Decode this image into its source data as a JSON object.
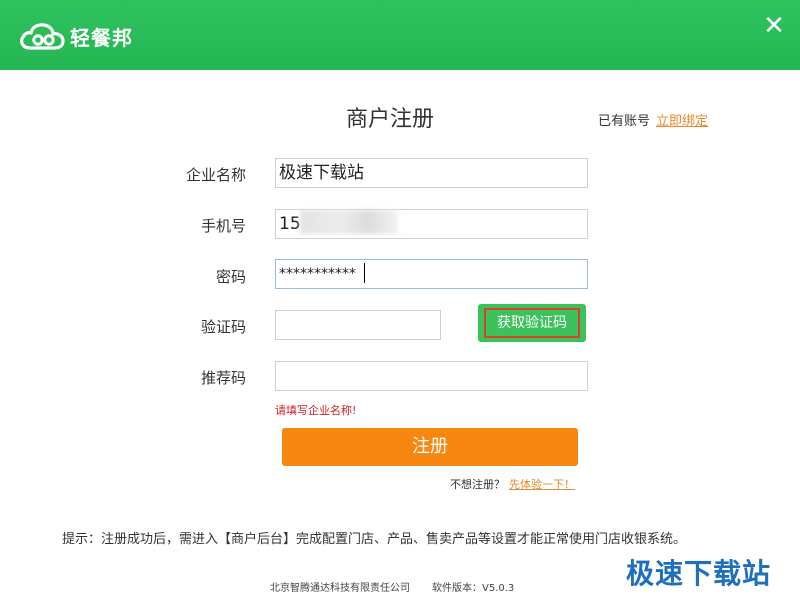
{
  "app": {
    "name": "轻餐邦"
  },
  "header": {
    "close_glyph": "✕",
    "accent_color": "#2fc35f"
  },
  "page": {
    "title": "商户注册"
  },
  "account": {
    "text": "已有账号",
    "link": "立即绑定"
  },
  "form": {
    "company": {
      "label": "企业名称",
      "value": "极速下载站"
    },
    "phone": {
      "label": "手机号",
      "value": "15"
    },
    "password": {
      "label": "密码",
      "value": "***********"
    },
    "code": {
      "label": "验证码",
      "value": "",
      "button": "获取验证码"
    },
    "referral": {
      "label": "推荐码",
      "value": ""
    }
  },
  "error_message": "请填写企业名称!",
  "register_button": "注册",
  "skip": {
    "text": "不想注册？",
    "link": "先体验一下！"
  },
  "tip": "提示：注册成功后，需进入【商户后台】完成配置门店、产品、售卖产品等设置才能正常使用门店收银系统。",
  "footer": {
    "company": "北京智腾通达科技有限责任公司",
    "version": "软件版本：V5.0.3"
  },
  "watermark": "极速下载站"
}
